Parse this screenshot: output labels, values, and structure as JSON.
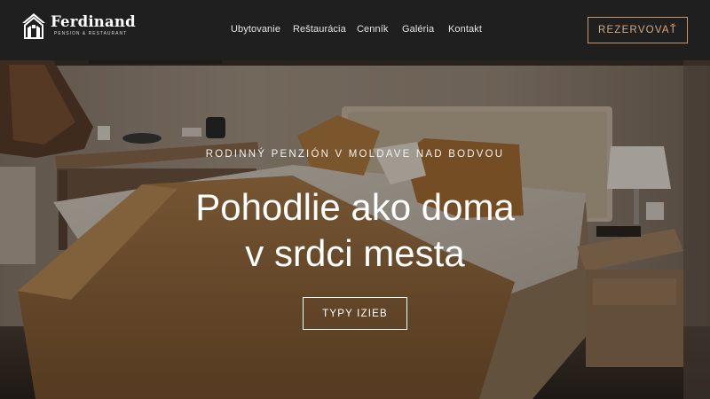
{
  "brand": {
    "name": "Ferdinand",
    "tagline": "PENSION & RESTAURANT",
    "icon": "house-logo-icon"
  },
  "nav": {
    "items": [
      {
        "label": "Ubytovanie"
      },
      {
        "label": "Reštaurácia"
      },
      {
        "label": "Cenník"
      },
      {
        "label": "Galéria"
      },
      {
        "label": "Kontakt"
      }
    ]
  },
  "header": {
    "reserve_label": "REZERVOVAŤ"
  },
  "hero": {
    "kicker": "RODINNÝ PENZIÓN V MOLDAVE NAD BODVOU",
    "title_line1": "Pohodlie ako doma",
    "title_line2": "v srdci mesta",
    "cta_label": "TYPY IZIEB",
    "image": "hotel-room-bed-photo"
  },
  "colors": {
    "header_bg": "#1f1f1f",
    "accent": "#c9976b",
    "text_light": "#ffffff"
  }
}
